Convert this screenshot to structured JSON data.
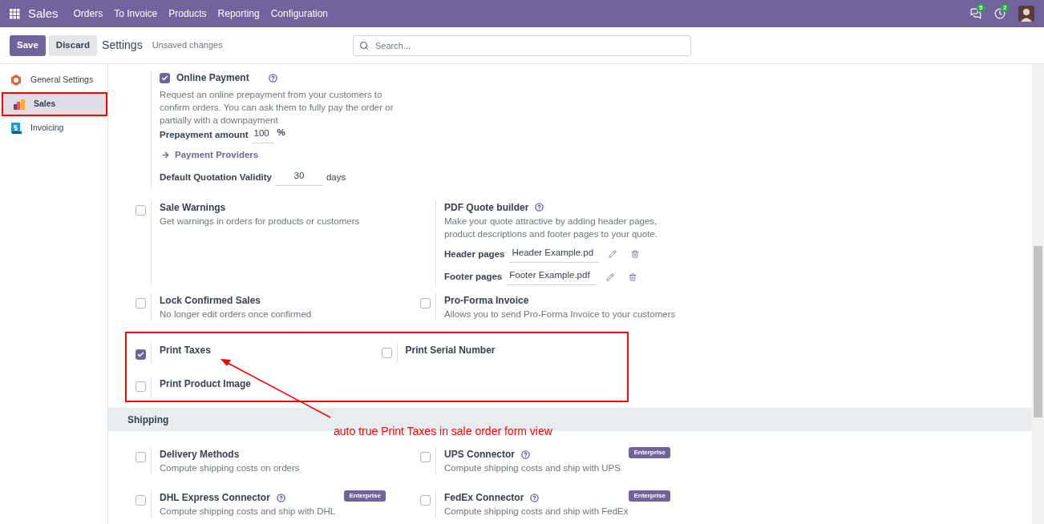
{
  "navbar": {
    "app": "Sales",
    "menu": [
      "Orders",
      "To Invoice",
      "Products",
      "Reporting",
      "Configuration"
    ],
    "notifications": [
      {
        "kind": "chat",
        "count": "5"
      },
      {
        "kind": "activity",
        "count": "2"
      }
    ]
  },
  "control_panel": {
    "buttons": [
      {
        "label": "Save",
        "kind": "primary"
      },
      {
        "label": "Discard",
        "kind": "secondary"
      }
    ],
    "title": "Settings",
    "status": "Unsaved changes",
    "search": {
      "placeholder": "Search..."
    }
  },
  "sidebar": {
    "items": [
      {
        "label": "General Settings",
        "kind": "general",
        "selected": false,
        "annotated": false
      },
      {
        "label": "Sales",
        "kind": "sales",
        "selected": true,
        "annotated": true
      },
      {
        "label": "Invoicing",
        "kind": "invoicing",
        "selected": false,
        "annotated": false
      }
    ]
  },
  "online_payment": {
    "label": "Online Payment",
    "checked": true,
    "help": true,
    "description": "Request an online prepayment from your customers to confirm orders. You can ask them to fully pay the order or partially with a downpayment",
    "prepayment": {
      "label": "Prepayment amount",
      "value": "100",
      "unit": "%"
    },
    "link": "Payment Providers",
    "validity": {
      "label": "Default Quotation Validity",
      "value": "30",
      "unit": "days"
    }
  },
  "rows": [
    [
      {
        "kind": "checkbox",
        "label": "Sale Warnings",
        "checked": false,
        "help": false,
        "description": "Get warnings in orders for products or customers"
      },
      {
        "kind": "info",
        "label": "PDF Quote builder",
        "help": true,
        "description": "Make your quote attractive by adding header pages, product descriptions and footer pages to your quote.",
        "files": [
          {
            "label": "Header pages",
            "value": "Header Example.pd"
          },
          {
            "label": "Footer pages",
            "value": "Footer Example.pdf"
          }
        ]
      }
    ],
    [
      {
        "kind": "checkbox",
        "label": "Lock Confirmed Sales",
        "checked": false,
        "help": false,
        "description": "No longer edit orders once confirmed"
      },
      {
        "kind": "checkbox",
        "label": "Pro-Forma Invoice",
        "checked": false,
        "help": false,
        "description": "Allows you to send Pro-Forma Invoice to your customers"
      }
    ]
  ],
  "annotated_rows": [
    [
      {
        "kind": "checkbox",
        "label": "Print Taxes",
        "checked": true,
        "help": false
      },
      {
        "kind": "checkbox",
        "label": "Print Serial Number",
        "checked": false,
        "help": false
      }
    ],
    [
      {
        "kind": "checkbox",
        "label": "Print Product Image",
        "checked": false,
        "help": false
      }
    ]
  ],
  "shipping": {
    "title": "Shipping",
    "rows": [
      [
        {
          "kind": "checkbox",
          "label": "Delivery Methods",
          "checked": false,
          "help": false,
          "description": "Compute shipping costs on orders"
        },
        {
          "kind": "checkbox",
          "label": "UPS Connector",
          "checked": false,
          "help": true,
          "badge": "Enterprise",
          "description": "Compute shipping costs and ship with UPS"
        }
      ],
      [
        {
          "kind": "checkbox",
          "label": "DHL Express Connector",
          "checked": false,
          "help": true,
          "badge": "Enterprise",
          "description": "Compute shipping costs and ship with DHL"
        },
        {
          "kind": "checkbox",
          "label": "FedEx Connector",
          "checked": false,
          "help": true,
          "badge": "Enterprise",
          "description": "Compute shipping costs and ship with FedEx"
        }
      ]
    ]
  },
  "annotation": {
    "text": "auto true Print Taxes in sale order form view"
  }
}
